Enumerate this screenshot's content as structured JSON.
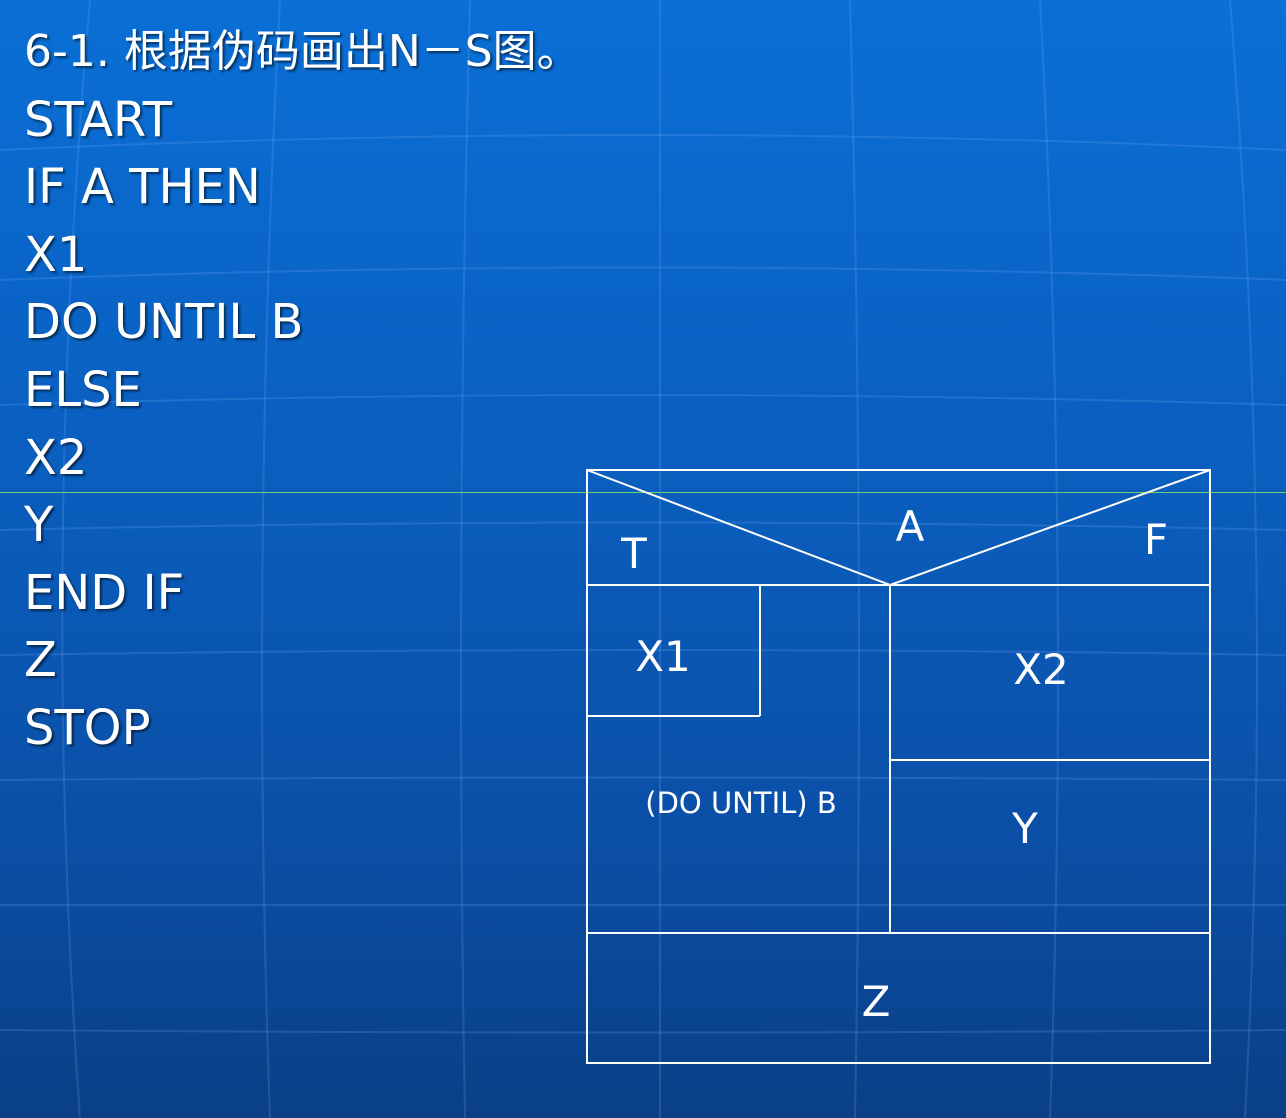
{
  "pseudocode": {
    "title": "6-1.    根据伪码画出N－S图。",
    "lines": [
      "START",
      "IF A THEN",
      "X1",
      "DO UNTIL B",
      "ELSE",
      "X2",
      "Y",
      "END IF",
      "Z",
      "STOP"
    ]
  },
  "ns_diagram": {
    "condition": "A",
    "true_label": "T",
    "false_label": "F",
    "loop_body": "X1",
    "loop_condition": "(DO UNTIL) B",
    "else_first": "X2",
    "else_second": "Y",
    "after": "Z"
  },
  "colors": {
    "background_top": "#0a6fd6",
    "background_bottom": "#0a3f86",
    "text": "#ffffff",
    "guide_line": "#6fd06a"
  }
}
